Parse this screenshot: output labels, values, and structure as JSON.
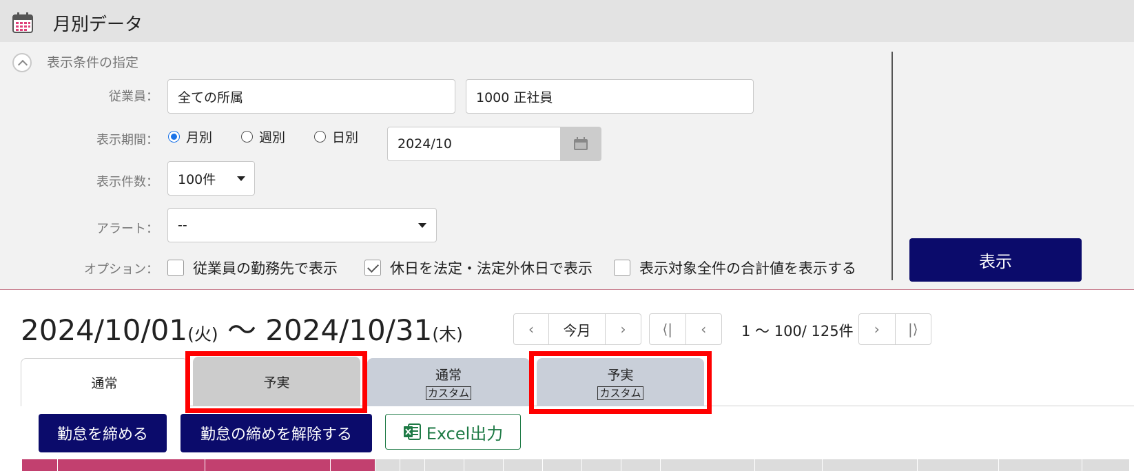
{
  "header": {
    "title": "月別データ",
    "icon": "calendar-icon"
  },
  "filters": {
    "section_label": "表示条件の指定",
    "employee": {
      "label": "従業員：",
      "department_value": "全ての所属",
      "type_value": "1000 正社員"
    },
    "period": {
      "label": "表示期間：",
      "options": [
        "月別",
        "週別",
        "日別"
      ],
      "selected": "月別",
      "value": "2024/10"
    },
    "count": {
      "label": "表示件数：",
      "value": "100件"
    },
    "alert": {
      "label": "アラート：",
      "value": "--"
    },
    "options": {
      "label": "オプション：",
      "items": [
        {
          "label": "従業員の勤務先で表示",
          "checked": false
        },
        {
          "label": "休日を法定・法定外休日で表示",
          "checked": true
        },
        {
          "label": "表示対象全件の合計値を表示する",
          "checked": false
        }
      ]
    },
    "show_button": "表示"
  },
  "range": {
    "start": "2024/10/01",
    "start_dow": "(火)",
    "separator": " ～ ",
    "end": "2024/10/31",
    "end_dow": "(木)"
  },
  "nav": {
    "prev": "‹",
    "this_month": "今月",
    "next": "›",
    "first": "⟨|",
    "page_prev": "‹",
    "page_text": "1 ～ 100/ 125件",
    "page_next": "›",
    "last": "|⟩"
  },
  "tabs": [
    {
      "label": "通常",
      "sub": ""
    },
    {
      "label": "予実",
      "sub": ""
    },
    {
      "label": "通常",
      "sub": "カスタム"
    },
    {
      "label": "予実",
      "sub": "カスタム"
    }
  ],
  "actions": {
    "close": "勤怠を締める",
    "unclose": "勤怠の締めを解除する",
    "excel": "Excel出力"
  },
  "colors": {
    "navy": "#0b0b6b",
    "highlight": "#ff0000",
    "excel_green": "#1e7a45",
    "header_pink": "#c2406f"
  }
}
